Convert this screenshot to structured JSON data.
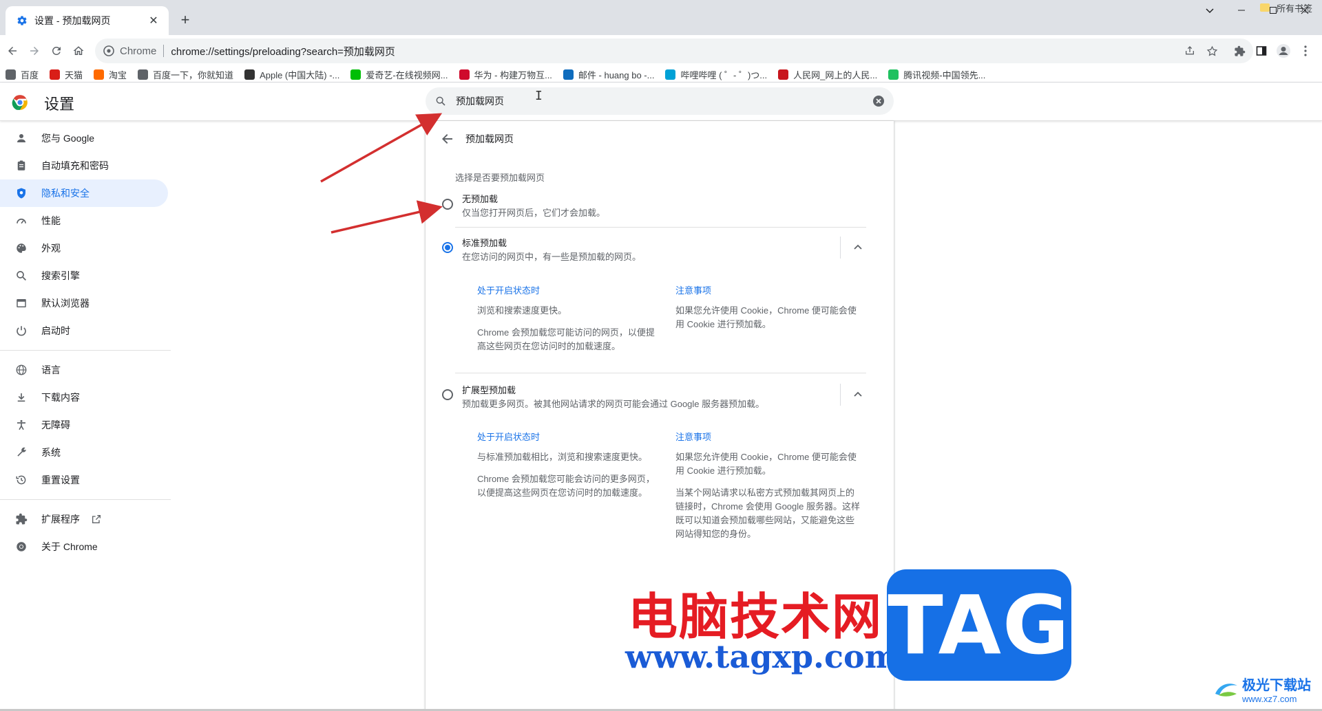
{
  "tab": {
    "title": "设置 - 预加载网页",
    "close": "✕",
    "new_tab": "+"
  },
  "toolbar": {
    "site_label": "Chrome",
    "url_path": "chrome://settings/preloading?search=预加载网页"
  },
  "bookmarks": [
    {
      "label": "百度",
      "color": "#5f6368"
    },
    {
      "label": "天猫",
      "color": "#d91e18"
    },
    {
      "label": "淘宝",
      "color": "#ff6a00"
    },
    {
      "label": "百度一下，你就知道",
      "color": "#5f6368"
    },
    {
      "label": "Apple (中国大陆) -...",
      "color": "#333333"
    },
    {
      "label": "爱奇艺-在线视频网...",
      "color": "#00be06"
    },
    {
      "label": "华为 - 构建万物互...",
      "color": "#cf0a2c"
    },
    {
      "label": "邮件 - huang bo -...",
      "color": "#0f6cbd"
    },
    {
      "label": "哔哩哔哩 ( ゜- ゜)つ...",
      "color": "#00a1d6"
    },
    {
      "label": "人民网_网上的人民...",
      "color": "#c8161d"
    },
    {
      "label": "腾讯视频-中国领先...",
      "color": "#20c160"
    }
  ],
  "bookmarks_right": "所有书签",
  "settings": {
    "title": "设置",
    "search_value": "预加载网页"
  },
  "sidebar": {
    "items": [
      {
        "label": "您与 Google",
        "icon": "person-icon"
      },
      {
        "label": "自动填充和密码",
        "icon": "clipboard-icon"
      },
      {
        "label": "隐私和安全",
        "icon": "shield-icon",
        "active": true
      },
      {
        "label": "性能",
        "icon": "speedometer-icon"
      },
      {
        "label": "外观",
        "icon": "palette-icon"
      },
      {
        "label": "搜索引擎",
        "icon": "search-icon"
      },
      {
        "label": "默认浏览器",
        "icon": "browser-icon"
      },
      {
        "label": "启动时",
        "icon": "power-icon"
      }
    ],
    "items2": [
      {
        "label": "语言",
        "icon": "globe-icon"
      },
      {
        "label": "下载内容",
        "icon": "download-icon"
      },
      {
        "label": "无障碍",
        "icon": "accessibility-icon"
      },
      {
        "label": "系统",
        "icon": "wrench-icon"
      },
      {
        "label": "重置设置",
        "icon": "history-icon"
      }
    ],
    "extensions": "扩展程序",
    "about": "关于 Chrome"
  },
  "card": {
    "title": "预加载网页",
    "section_label": "选择是否要预加载网页",
    "options": [
      {
        "title": "无预加载",
        "sub": "仅当您打开网页后，它们才会加载。",
        "selected": false
      },
      {
        "title": "标准预加载",
        "sub": "在您访问的网页中，有一些是预加载的网页。",
        "selected": true,
        "left_heading": "处于开启状态时",
        "left_p1": "浏览和搜索速度更快。",
        "left_p2": "Chrome 会预加载您可能访问的网页，以便提高这些网页在您访问时的加载速度。",
        "right_heading": "注意事项",
        "right_p1": "如果您允许使用 Cookie，Chrome 便可能会使用 Cookie 进行预加载。"
      },
      {
        "title": "扩展型预加载",
        "sub": "预加载更多网页。被其他网站请求的网页可能会通过 Google 服务器预加载。",
        "selected": false,
        "left_heading": "处于开启状态时",
        "left_p1": "与标准预加载相比，浏览和搜索速度更快。",
        "left_p2": "Chrome 会预加载您可能会访问的更多网页，以便提高这些网页在您访问时的加载速度。",
        "right_heading": "注意事项",
        "right_p1": "如果您允许使用 Cookie，Chrome 便可能会使用 Cookie 进行预加载。",
        "right_p2": "当某个网站请求以私密方式预加载其网页上的链接时，Chrome 会使用 Google 服务器。这样既可以知道会预加载哪些网站，又能避免这些网站得知您的身份。"
      }
    ]
  },
  "watermark": {
    "cn": "电脑技术网",
    "url": "www.tagxp.com",
    "tag": "TAG",
    "corner1": "极光下载站",
    "corner2": "www.xz7.com"
  },
  "colors": {
    "accent": "#1a73e8",
    "arrow": "#d32f2f"
  }
}
